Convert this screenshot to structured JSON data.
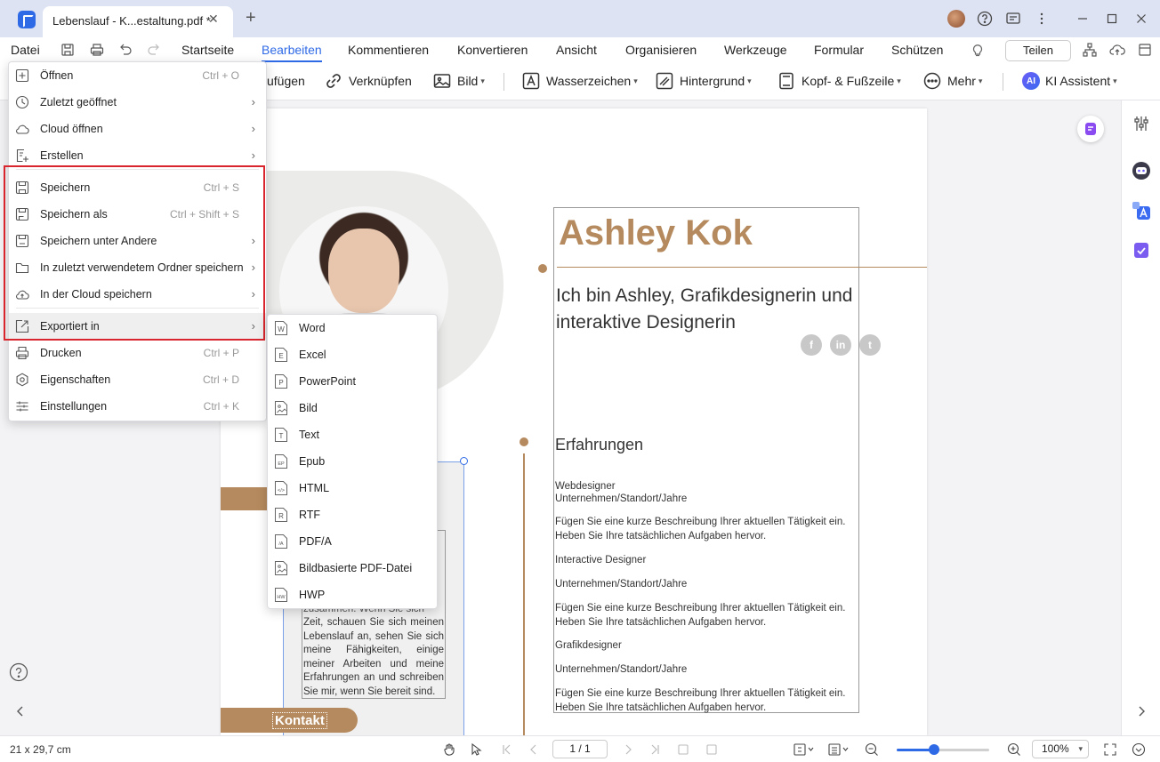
{
  "window": {
    "tab_title": "Lebenslauf - K...estaltung.pdf *",
    "tab_close": "✕",
    "tab_new": "+"
  },
  "menubar": {
    "file_label": "Datei",
    "tabs": [
      "Startseite",
      "Bearbeiten",
      "Kommentieren",
      "Konvertieren",
      "Ansicht",
      "Organisieren",
      "Werkzeuge",
      "Formular",
      "Schützen"
    ],
    "active_tab": "Bearbeiten",
    "share_label": "Teilen"
  },
  "ribbon": {
    "partial_label": "ufügen",
    "link_label": "Verknüpfen",
    "image_label": "Bild",
    "watermark_label": "Wasserzeichen",
    "background_label": "Hintergrund",
    "header_footer_label": "Kopf- & Fußzeile",
    "more_label": "Mehr",
    "ai_badge": "AI",
    "ai_label": "KI Assistent"
  },
  "file_menu": {
    "items": [
      {
        "label": "Öffnen",
        "shortcut": "Ctrl + O",
        "submenu": false,
        "icon": "plus-square-icon"
      },
      {
        "label": "Zuletzt geöffnet",
        "shortcut": "",
        "submenu": true,
        "icon": "clock-icon"
      },
      {
        "label": "Cloud öffnen",
        "shortcut": "",
        "submenu": true,
        "icon": "cloud-icon"
      },
      {
        "label": "Erstellen",
        "shortcut": "",
        "submenu": true,
        "icon": "create-icon"
      },
      {
        "label": "Speichern",
        "shortcut": "Ctrl + S",
        "submenu": false,
        "icon": "save-icon"
      },
      {
        "label": "Speichern als",
        "shortcut": "Ctrl + Shift + S",
        "submenu": false,
        "icon": "save-as-icon"
      },
      {
        "label": "Speichern unter Andere",
        "shortcut": "",
        "submenu": true,
        "icon": "save-other-icon"
      },
      {
        "label": "In zuletzt verwendetem Ordner speichern",
        "shortcut": "",
        "submenu": true,
        "icon": "folder-icon"
      },
      {
        "label": "In der Cloud speichern",
        "shortcut": "",
        "submenu": true,
        "icon": "cloud-upload-icon"
      },
      {
        "label": "Exportiert in",
        "shortcut": "",
        "submenu": true,
        "icon": "export-icon"
      },
      {
        "label": "Drucken",
        "shortcut": "Ctrl + P",
        "submenu": false,
        "icon": "printer-icon"
      },
      {
        "label": "Eigenschaften",
        "shortcut": "Ctrl + D",
        "submenu": false,
        "icon": "properties-icon"
      },
      {
        "label": "Einstellungen",
        "shortcut": "Ctrl + K",
        "submenu": false,
        "icon": "settings-sliders-icon"
      }
    ]
  },
  "export_menu": {
    "items": [
      {
        "label": "Word",
        "glyph": "W"
      },
      {
        "label": "Excel",
        "glyph": "E"
      },
      {
        "label": "PowerPoint",
        "glyph": "P"
      },
      {
        "label": "Bild",
        "glyph": ""
      },
      {
        "label": "Text",
        "glyph": "T"
      },
      {
        "label": "Epub",
        "glyph": "EP"
      },
      {
        "label": "HTML",
        "glyph": "</>"
      },
      {
        "label": "RTF",
        "glyph": "R"
      },
      {
        "label": "PDF/A",
        "glyph": "/A"
      },
      {
        "label": "Bildbasierte PDF-Datei",
        "glyph": ""
      },
      {
        "label": "HWP",
        "glyph": "HW"
      }
    ]
  },
  "resume": {
    "name": "Ashley Kok",
    "intro": "Ich bin Ashley, Grafikdesignerin und interaktive Designerin",
    "social": [
      "f",
      "in",
      "t"
    ],
    "section_experience": "Erfahrungen",
    "job1_title": "Webdesigner",
    "job1_company": "Unternehmen/Standort/Jahre",
    "job1_desc": "Fügen Sie eine kurze Beschreibung Ihrer aktuellen Tätigkeit ein. Heben Sie Ihre tatsächlichen Aufgaben hervor.",
    "job2_title": "Interactive Designer",
    "job2_company": "Unternehmen/Standort/Jahre",
    "job2_desc": "Fügen Sie eine kurze Beschreibung Ihrer aktuellen Tätigkeit ein. Heben Sie Ihre tatsächlichen Aufgaben hervor.",
    "job3_title": "Grafikdesigner",
    "job3_company": "Unternehmen/Standort/Jahre",
    "job3_desc": "Fügen Sie eine kurze Beschreibung Ihrer aktuellen Tätigkeit ein. Heben Sie Ihre tatsächlichen Aufgaben hervor.",
    "left_text_partial": "zusammen. Wenn Sie sich",
    "left_text": "Zeit, schauen Sie sich meinen Lebenslauf an, sehen Sie sich meine Fähigkeiten, einige meiner Arbeiten und meine Erfahrungen an und schreiben Sie mir, wenn Sie bereit sind.",
    "contact_label": "Kontakt"
  },
  "statusbar": {
    "page_size": "21 x 29,7 cm",
    "page_indicator": "1 / 1",
    "zoom_level": "100%",
    "zoom_fraction": 0.4
  },
  "colors": {
    "accent": "#2f6ae6",
    "resume_brown": "#b58a5e",
    "highlight_red": "#d9262e"
  }
}
